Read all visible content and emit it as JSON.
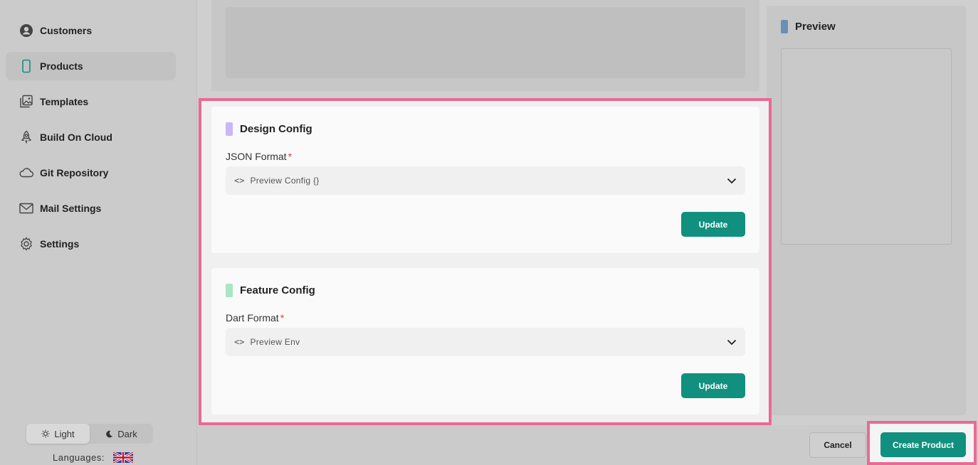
{
  "sidebar": {
    "items": [
      {
        "label": "Customers",
        "icon": "user-circle-icon"
      },
      {
        "label": "Products",
        "icon": "phone-icon"
      },
      {
        "label": "Templates",
        "icon": "images-icon"
      },
      {
        "label": "Build On Cloud",
        "icon": "rocket-icon"
      },
      {
        "label": "Git Repository",
        "icon": "cloud-icon"
      },
      {
        "label": "Mail Settings",
        "icon": "mail-icon"
      },
      {
        "label": "Settings",
        "icon": "gear-icon"
      }
    ],
    "active_item": "Products",
    "theme": {
      "light_label": "Light",
      "dark_label": "Dark",
      "selected": "Light"
    },
    "languages_label": "Languages:"
  },
  "preview": {
    "title": "Preview"
  },
  "design_config": {
    "title": "Design Config",
    "field_label": "JSON Format",
    "required_mark": "*",
    "select_value": "Preview Config {}",
    "update_label": "Update",
    "accent_color": "#c9b8f5"
  },
  "feature_config": {
    "title": "Feature Config",
    "field_label": "Dart Format",
    "required_mark": "*",
    "select_value": "Preview Env",
    "update_label": "Update",
    "accent_color": "#a8e6c6"
  },
  "footer": {
    "cancel_label": "Cancel",
    "create_label": "Create Product"
  },
  "colors": {
    "primary": "#11907f",
    "highlight": "#e96a94",
    "preview_accent": "#6a8fb5"
  }
}
